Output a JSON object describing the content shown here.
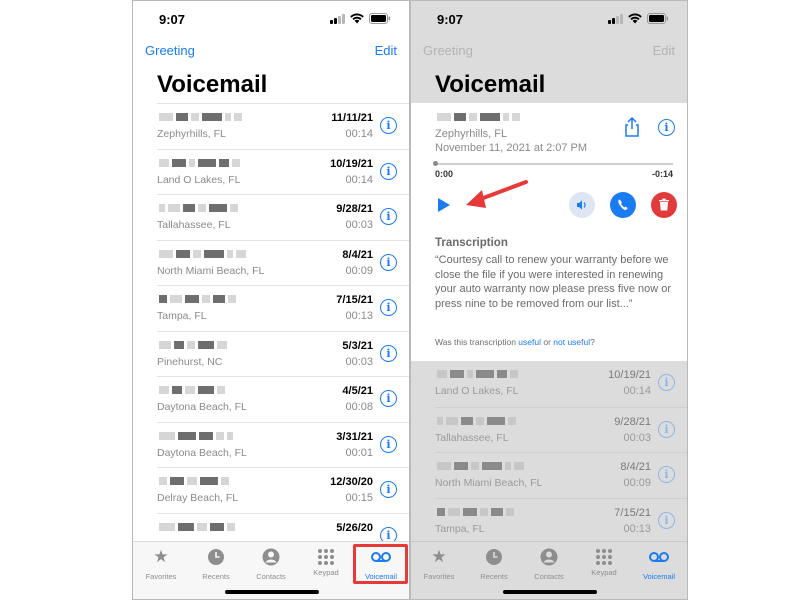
{
  "left": {
    "status_time": "9:07",
    "nav_left": "Greeting",
    "nav_right": "Edit",
    "title": "Voicemail",
    "rows": [
      {
        "place": "Zephyrhills, FL",
        "date": "11/11/21",
        "duration": "00:14"
      },
      {
        "place": "Land O Lakes, FL",
        "date": "10/19/21",
        "duration": "00:14"
      },
      {
        "place": "Tallahassee, FL",
        "date": "9/28/21",
        "duration": "00:03"
      },
      {
        "place": "North Miami Beach, FL",
        "date": "8/4/21",
        "duration": "00:09"
      },
      {
        "place": "Tampa, FL",
        "date": "7/15/21",
        "duration": "00:13"
      },
      {
        "place": "Pinehurst, NC",
        "date": "5/3/21",
        "duration": "00:03"
      },
      {
        "place": "Daytona Beach, FL",
        "date": "4/5/21",
        "duration": "00:08"
      },
      {
        "place": "Daytona Beach, FL",
        "date": "3/31/21",
        "duration": "00:01"
      },
      {
        "place": "Delray Beach, FL",
        "date": "12/30/20",
        "duration": "00:15"
      },
      {
        "place": "",
        "date": "5/26/20",
        "duration": ""
      }
    ]
  },
  "right": {
    "status_time": "9:07",
    "nav_left": "Greeting",
    "nav_right": "Edit",
    "title": "Voicemail",
    "detail": {
      "place": "Zephyrhills, FL",
      "when": "November 11, 2021 at 2:07 PM",
      "time_start": "0:00",
      "time_end": "-0:14",
      "progress": 0.0
    },
    "transcription": {
      "heading": "Transcription",
      "text": "“Courtesy call to renew your warranty before we close the file if you were interested in renewing your auto warranty now please press five now or press nine to be removed from our list...”",
      "question_prefix": "Was this transcription ",
      "useful": "useful",
      "or": " or ",
      "not_useful": "not useful",
      "question_suffix": "?"
    },
    "rows": [
      {
        "place": "Land O Lakes, FL",
        "date": "10/19/21",
        "duration": "00:14"
      },
      {
        "place": "Tallahassee, FL",
        "date": "9/28/21",
        "duration": "00:03"
      },
      {
        "place": "North Miami Beach, FL",
        "date": "8/4/21",
        "duration": "00:09"
      },
      {
        "place": "Tampa, FL",
        "date": "7/15/21",
        "duration": "00:13"
      }
    ]
  },
  "tabs": [
    {
      "label": "Favorites",
      "icon": "star-icon"
    },
    {
      "label": "Recents",
      "icon": "clock-icon"
    },
    {
      "label": "Contacts",
      "icon": "person-icon"
    },
    {
      "label": "Keypad",
      "icon": "keypad-icon"
    },
    {
      "label": "Voicemail",
      "icon": "voicemail-icon"
    }
  ],
  "colors": {
    "accent": "#1a7cf0",
    "delete": "#e23b3b",
    "highlight": "#e8393a",
    "arrow": "#e8393a",
    "dim_overlay": "#dcdcdc"
  }
}
